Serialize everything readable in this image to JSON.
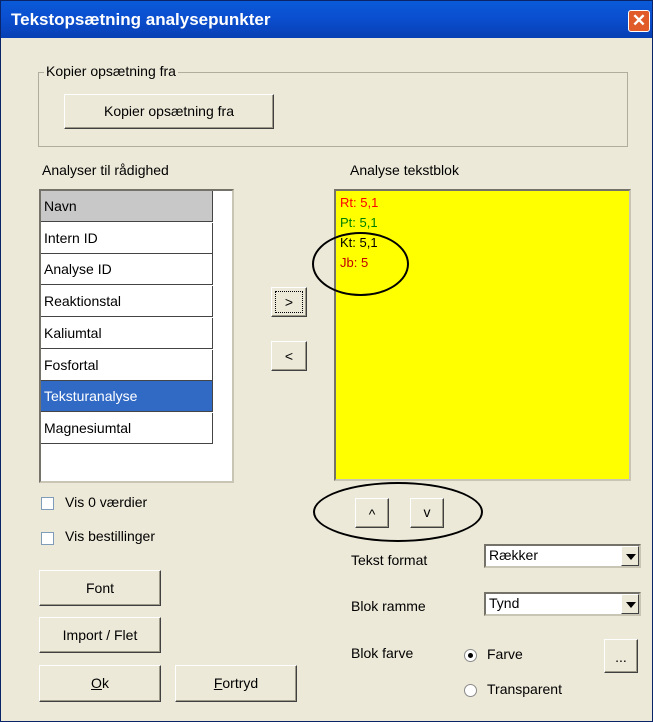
{
  "window": {
    "title": "Tekstopsætning analysepunkter",
    "close_glyph": "✕"
  },
  "copy_group": {
    "legend": "Kopier opsætning fra",
    "button_label": "Kopier opsætning fra"
  },
  "available": {
    "label": "Analyser til rådighed",
    "items": [
      "Navn",
      "Intern ID",
      "Analyse ID",
      "Reaktionstal",
      "Kaliumtal",
      "Fosfortal",
      "Teksturanalyse",
      "Magnesiumtal"
    ],
    "header_item": "Navn",
    "selected_item": "Teksturanalyse"
  },
  "transfer": {
    "add_label": ">",
    "remove_label": "<"
  },
  "textblock": {
    "label": "Analyse tekstblok",
    "background": "#ffff00",
    "lines": [
      {
        "text": "Rt: 5,1",
        "color": "#ff0000"
      },
      {
        "text": "Pt: 5,1",
        "color": "#008000"
      },
      {
        "text": "Kt: 5,1",
        "color": "#000000"
      },
      {
        "text": "Jb: 5",
        "color": "#c00000"
      }
    ]
  },
  "order": {
    "up_label": "^",
    "down_label": "v"
  },
  "options": {
    "show_zero_label": "Vis 0 værdier",
    "show_zero_checked": false,
    "show_orders_label": "Vis bestillinger",
    "show_orders_checked": false
  },
  "buttons": {
    "font": "Font",
    "import": "Import / Flet",
    "ok_underlined": "O",
    "ok_rest": "k",
    "cancel_underlined": "F",
    "cancel_rest": "ortryd",
    "more": "..."
  },
  "format": {
    "text_format_label": "Tekst format",
    "text_format_value": "Rækker",
    "frame_label": "Blok ramme",
    "frame_value": "Tynd",
    "color_label": "Blok farve",
    "color_option": "Farve",
    "transparent_option": "Transparent",
    "selected_option": "Farve"
  }
}
